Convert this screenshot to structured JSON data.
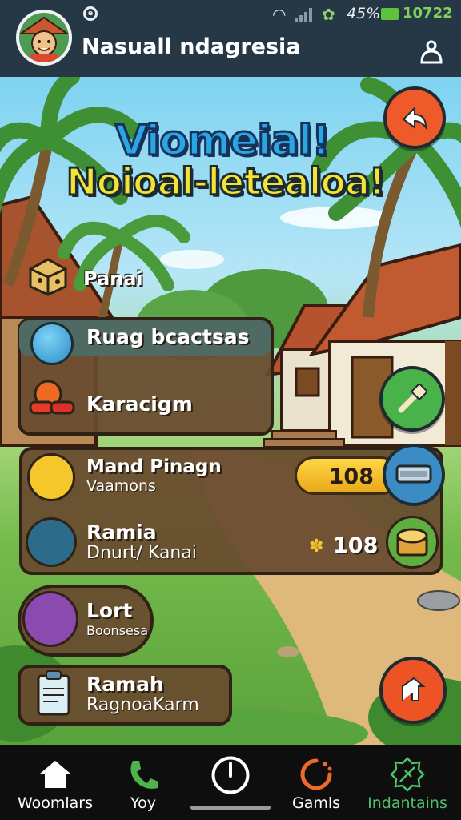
{
  "status_bar": {
    "battery": "45%",
    "time": "10722"
  },
  "header": {
    "title": "Nasuall ndagresia"
  },
  "hero": {
    "line1": "Viomeial!",
    "line2": "Noioal-letealoa!"
  },
  "section": {
    "label": "Panai"
  },
  "menu": {
    "item1": "Ruag bcactsas",
    "item2": "Karacigm"
  },
  "shop": {
    "item1_title": "Mand Pinagn",
    "item1_sub": "Vaamons",
    "item1_value": "108",
    "item2_title": "Ramia",
    "item2_sub": "Dnurt/ Kanai",
    "item2_value": "108"
  },
  "extra": {
    "lort_title": "Lort",
    "lort_sub": "Boonsesa",
    "ramah_title": "Ramah",
    "ramah_sub": "RagnoaKarm"
  },
  "nav": {
    "items": [
      {
        "label": "Woomlars",
        "icon": "home-icon"
      },
      {
        "label": "Yoy",
        "icon": "phone-icon"
      },
      {
        "label": "",
        "icon": "power-icon"
      },
      {
        "label": "Gamls",
        "icon": "loading-icon"
      },
      {
        "label": "Indantains",
        "icon": "leaf-badge-icon",
        "active": true
      }
    ]
  },
  "colors": {
    "header_bg": "#263846",
    "panel": "#684a2e",
    "accent_yellow": "#f2e335",
    "accent_blue": "#2ba6e4",
    "nav_active": "#4fc06a"
  }
}
